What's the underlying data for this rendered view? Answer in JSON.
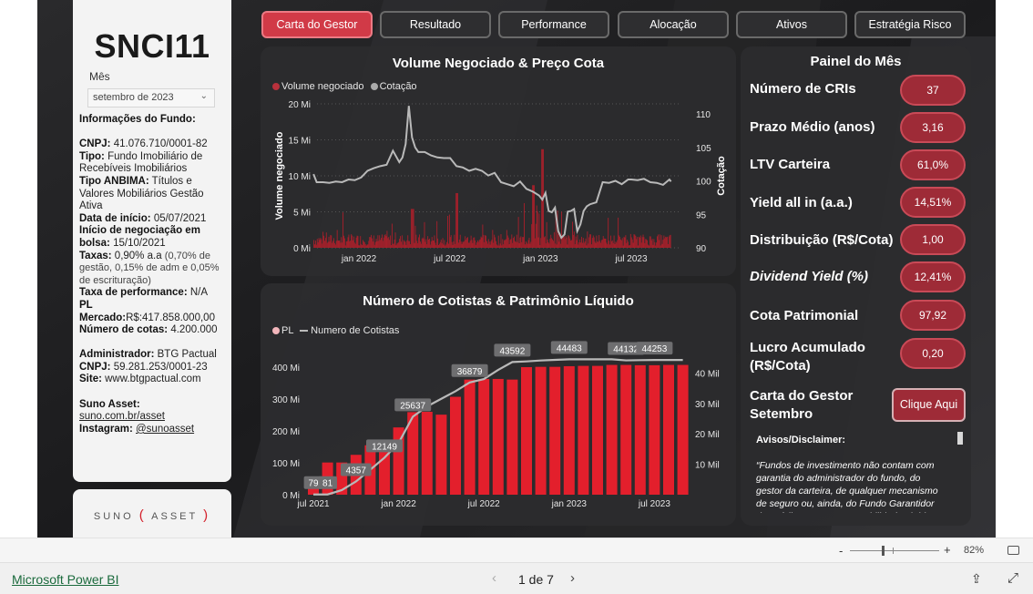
{
  "fund": {
    "ticker": "SNCI11",
    "month_label": "Mês",
    "month_value": "setembro de 2023",
    "info_heading": "Informações do Fundo:",
    "cnpj_label": "CNPJ:",
    "cnpj_value": "41.076.710/0001-82",
    "tipo_label": "Tipo:",
    "tipo_value": "Fundo Imobiliário de Recebíveis Imobiliários",
    "anbima_label": "Tipo ANBIMA:",
    "anbima_value": "Títulos e Valores Mobiliários Gestão Ativa",
    "inicio_label": "Data de início:",
    "inicio_value": "05/07/2021",
    "negoc_label": "Início de negociação em bolsa:",
    "negoc_value": "15/10/2021",
    "taxas_label": "Taxas:",
    "taxas_value": "0,90% a.a",
    "taxas_detail": "(0,70% de gestão, 0,15% de adm e 0,05% de escrituração)",
    "perf_label": "Taxa de performance:",
    "perf_value": "N/A",
    "pl_label": "PL Mercado:",
    "pl_value": "R$:417.858.000,00",
    "cotas_label": "Número de cotas:",
    "cotas_value": "4.200.000",
    "admin_label": "Administrador:",
    "admin_value": "BTG Pactual",
    "admin_cnpj_label": "CNPJ:",
    "admin_cnpj_value": "59.281.253/0001-23",
    "site_label": "Site:",
    "site_value": "www.btgpactual.com",
    "suno_label": "Suno Asset:",
    "suno_value": "suno.com.br/asset",
    "insta_label": "Instagram:",
    "insta_value": "@sunoasset",
    "logo_left": "SUNO",
    "logo_paren_open": "(",
    "logo_right": "ASSET",
    "logo_paren_close": ")"
  },
  "tabs": [
    "Carta do Gestor",
    "Resultado",
    "Performance",
    "Alocação",
    "Ativos",
    "Estratégia Risco"
  ],
  "active_tab": 0,
  "kpi_panel": {
    "title": "Painel do Mês",
    "items": [
      {
        "label": "Número de CRIs",
        "value": "37"
      },
      {
        "label": "Prazo Médio (anos)",
        "value": "3,16"
      },
      {
        "label": "LTV Carteira",
        "value": "61,0%"
      },
      {
        "label": "Yield all in (a.a.)",
        "value": "14,51%"
      },
      {
        "label": "Distribuição (R$/Cota)",
        "value": "1,00"
      },
      {
        "label": "Dividend Yield (%)",
        "value": "12,41%"
      },
      {
        "label": "Cota Patrimonial",
        "value": "97,92"
      },
      {
        "label": "Lucro Acumulado (R$/Cota)",
        "value": "0,20"
      }
    ],
    "cta_label": "Carta do Gestor Setembro",
    "cta_button": "Clique Aqui",
    "info_icon_text": "i",
    "disclaimer_title": "Avisos/Disclaimer:",
    "disclaimer_text": "“Fundos de investimento não contam com garantia do administrador do fundo, do gestor da carteira, de qualquer mecanismo de seguro ou, ainda, do Fundo Garantidor de Créditos - FGC. A rentabilidade obtida no passado não"
  },
  "colors": {
    "accent": "#d13a47",
    "bar": "#e31f2c",
    "bar_dark": "#a8202b",
    "line": "#b9b9b9",
    "pill": "#9e2b37"
  },
  "chart_data": [
    {
      "type": "line",
      "title": "Volume Negociado & Preço Cota",
      "legend": [
        "Volume negociado",
        "Cotação"
      ],
      "ylabel": "Volume negociado",
      "y2label": "Cotação",
      "y_ticks": [
        "0 Mi",
        "5 Mi",
        "10 Mi",
        "15 Mi",
        "20 Mi"
      ],
      "ylim": [
        0,
        20
      ],
      "y2_ticks": [
        "90",
        "95",
        "100",
        "105",
        "110"
      ],
      "y2lim": [
        90,
        111.5
      ],
      "x_ticks": [
        "jan 2022",
        "jul 2022",
        "jan 2023",
        "jul 2023"
      ],
      "x_tick_pos": [
        0.1429,
        0.4286,
        0.7143,
        1.0
      ],
      "price": {
        "x": [
          0,
          0.01,
          0.03,
          0.05,
          0.07,
          0.09,
          0.11,
          0.13,
          0.15,
          0.17,
          0.19,
          0.21,
          0.23,
          0.25,
          0.27,
          0.28,
          0.29,
          0.3,
          0.31,
          0.32,
          0.33,
          0.35,
          0.37,
          0.39,
          0.41,
          0.43,
          0.45,
          0.47,
          0.49,
          0.51,
          0.53,
          0.55,
          0.57,
          0.59,
          0.61,
          0.63,
          0.65,
          0.67,
          0.69,
          0.71,
          0.72,
          0.73,
          0.74,
          0.75,
          0.76,
          0.77,
          0.78,
          0.79,
          0.8,
          0.81,
          0.82,
          0.83,
          0.84,
          0.85,
          0.86,
          0.87,
          0.89,
          0.91,
          0.93,
          0.95,
          0.97,
          0.99,
          1.0,
          1.02,
          1.04,
          1.06,
          1.08,
          1.1,
          1.12,
          1.125
        ],
        "y": [
          101,
          99.8,
          99.8,
          99.7,
          99.9,
          99.8,
          100.2,
          100.1,
          100.5,
          101.5,
          101.9,
          102.2,
          102.4,
          104.5,
          102.8,
          103.5,
          105.5,
          111.2,
          106.5,
          105,
          104.3,
          104.3,
          103.8,
          103.5,
          103.4,
          103.4,
          102.2,
          102,
          101.5,
          101.8,
          101.5,
          100.8,
          101.2,
          99.8,
          99.5,
          99.2,
          99.9,
          98.8,
          98.4,
          97.8,
          97.2,
          98.2,
          95.5,
          95.3,
          96,
          92.5,
          91.5,
          92,
          95.4,
          95.5,
          95.8,
          92.5,
          93.5,
          95.5,
          96.2,
          96.5,
          96.8,
          99.8,
          99.7,
          100,
          99.5,
          100.2,
          100.2,
          100.1,
          100.3,
          99.8,
          99.7,
          99.4,
          100.2,
          99.9
        ]
      },
      "volume_note": "daily volume bars, mostly 0–5 Mi with spikes up to ~13.7 Mi around jan 2023"
    },
    {
      "type": "bar",
      "title": "Número de Cotistas & Patrimônio Líquido",
      "legend": [
        "PL",
        "Numero de Cotistas"
      ],
      "y_ticks": [
        "0 Mi",
        "100 Mi",
        "200 Mi",
        "300 Mi",
        "400 Mi"
      ],
      "ylim": [
        0,
        420
      ],
      "y2_ticks": [
        "10 Mil",
        "20 Mil",
        "30 Mil",
        "40 Mil"
      ],
      "y2lim": [
        0,
        44
      ],
      "x_ticks": [
        "jul 2021",
        "jan 2022",
        "jul 2022",
        "jan 2023",
        "jul 2023"
      ],
      "pl_values": [
        21,
        101,
        101,
        125,
        155,
        163,
        211,
        259,
        260,
        251,
        307,
        361,
        363,
        363,
        361,
        400,
        401,
        401,
        403,
        404,
        404,
        407,
        407,
        406,
        406,
        407,
        407
      ],
      "cotistas": [
        79,
        81,
        1500,
        4357,
        8200,
        12149,
        17000,
        25637,
        29000,
        31500,
        34000,
        36879,
        38000,
        41000,
        43592,
        43800,
        44100,
        44300,
        44483,
        44483,
        44483,
        44483,
        44132,
        44200,
        44253,
        44253,
        44253
      ],
      "labels": [
        {
          "i": 0,
          "text": "79"
        },
        {
          "i": 1,
          "text": "81"
        },
        {
          "i": 3,
          "text": "4357"
        },
        {
          "i": 5,
          "text": "12149"
        },
        {
          "i": 7,
          "text": "25637"
        },
        {
          "i": 11,
          "text": "36879"
        },
        {
          "i": 14,
          "text": "43592"
        },
        {
          "i": 18,
          "text": "44483"
        },
        {
          "i": 22,
          "text": "44132"
        },
        {
          "i": 24,
          "text": "44253"
        }
      ]
    }
  ],
  "footer": {
    "zoom_minus": "-",
    "zoom_plus": "+",
    "zoom": "82%",
    "powerbi": "Microsoft Power BI",
    "prev": "‹",
    "next": "›",
    "page": "1 de 7",
    "share_icon": "⇪",
    "expand_icon": "⤢"
  }
}
